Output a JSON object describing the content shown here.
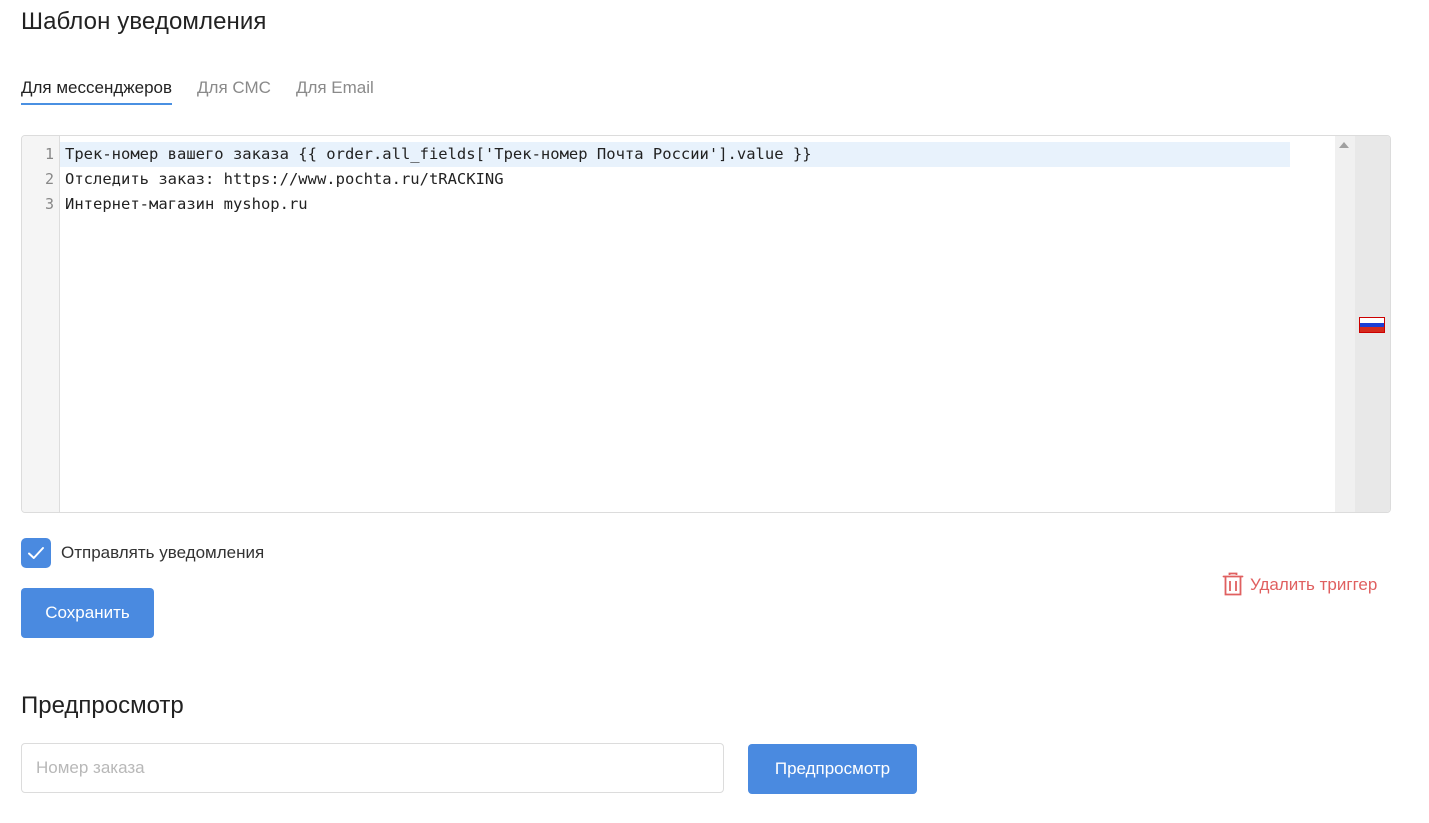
{
  "page": {
    "title": "Шаблон уведомления"
  },
  "tabs": [
    {
      "label": "Для мессенджеров",
      "active": true
    },
    {
      "label": "Для СМС",
      "active": false
    },
    {
      "label": "Для Email",
      "active": false
    }
  ],
  "editor": {
    "line_numbers": [
      "1",
      "2",
      "3"
    ],
    "lines": [
      "Трек-номер вашего заказа {{ order.all_fields['Трек-номер Почта России'].value }}",
      "Отследить заказ: https://www.pochta.ru/tRACKING",
      "Интернет-магазин myshop.ru"
    ],
    "active_line": 1,
    "flag_colors": [
      "#ffffff",
      "#1c3fd6",
      "#d52b1e"
    ]
  },
  "notifications": {
    "label": "Отправлять уведомления",
    "checked": true
  },
  "actions": {
    "save_label": "Сохранить",
    "delete_label": "Удалить триггер"
  },
  "preview": {
    "title": "Предпросмотр",
    "order_placeholder": "Номер заказа",
    "order_value": "",
    "button_label": "Предпросмотр"
  },
  "colors": {
    "accent": "#4a8ae0",
    "danger": "#e06060",
    "active_line_bg": "#e8f2fc",
    "tab_underline": "#4a90e2"
  },
  "icons": {
    "check": "checkmark-icon",
    "delete": "trash-icon",
    "scroll": "scroll-up-arrow-icon",
    "flag": "russia-flag-icon"
  }
}
